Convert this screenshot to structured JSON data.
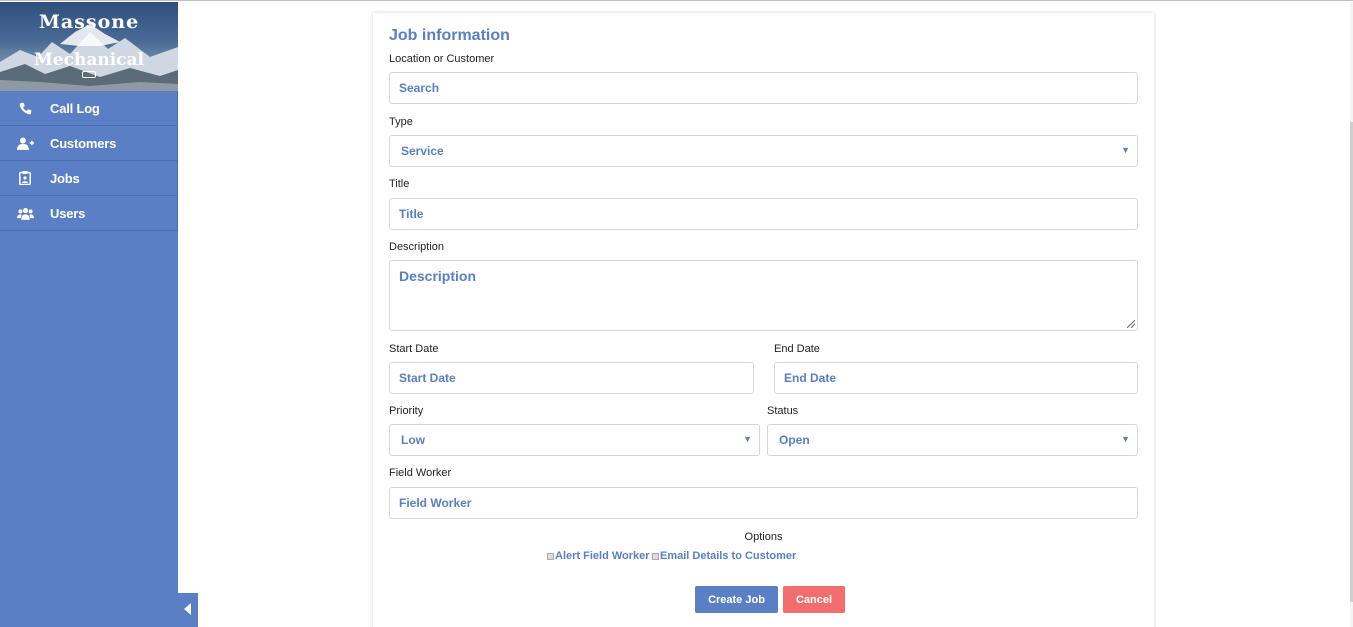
{
  "brand": {
    "line1": "Massone",
    "line2": "Mechanical"
  },
  "sidebar": {
    "items": [
      {
        "label": "Call Log",
        "icon": "phone-icon"
      },
      {
        "label": "Customers",
        "icon": "add-user-icon"
      },
      {
        "label": "Jobs",
        "icon": "clipboard-icon"
      },
      {
        "label": "Users",
        "icon": "users-icon"
      }
    ]
  },
  "form": {
    "title": "Job information",
    "location": {
      "label": "Location or Customer",
      "placeholder": "Search"
    },
    "type": {
      "label": "Type",
      "value": "Service"
    },
    "title_field": {
      "label": "Title",
      "placeholder": "Title"
    },
    "description": {
      "label": "Description",
      "placeholder": "Description"
    },
    "start_date": {
      "label": "Start Date",
      "placeholder": "Start Date"
    },
    "end_date": {
      "label": "End Date",
      "placeholder": "End Date"
    },
    "priority": {
      "label": "Priority",
      "value": "Low"
    },
    "status": {
      "label": "Status",
      "value": "Open"
    },
    "field_worker": {
      "label": "Field Worker",
      "placeholder": "Field Worker"
    },
    "options": {
      "title": "Options",
      "alert_field_worker": "Alert Field Worker",
      "email_customer": "Email Details to Customer"
    },
    "buttons": {
      "create": "Create Job",
      "cancel": "Cancel"
    }
  },
  "colors": {
    "accent": "#5b7fc4",
    "danger": "#f26d6d"
  }
}
